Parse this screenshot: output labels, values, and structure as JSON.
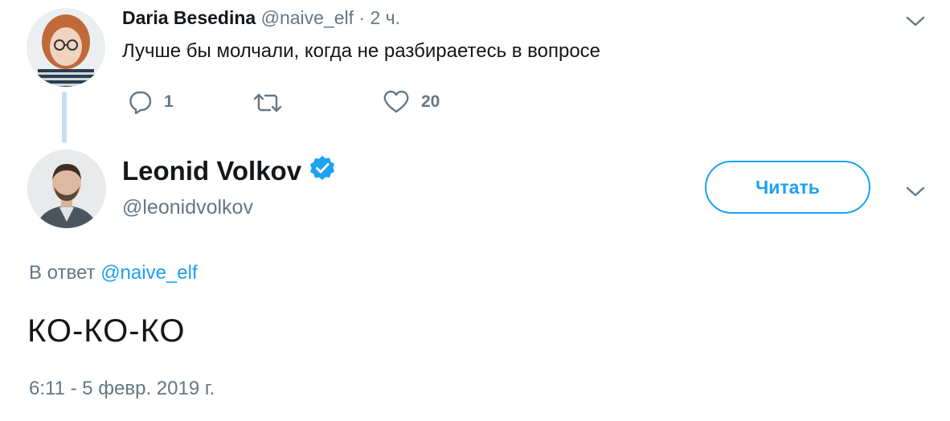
{
  "parent_tweet": {
    "author_name": "Daria Besedina",
    "author_handle": "@naive_elf",
    "separator": "·",
    "time_ago": "2 ч.",
    "text": "Лучше бы молчали, когда не разбираетесь в вопросе",
    "reply_count": "1",
    "retweet_count": "",
    "like_count": "20"
  },
  "main_tweet": {
    "author_name": "Leonid Volkov",
    "verified": true,
    "author_handle": "@leonidvolkov",
    "follow_label": "Читать",
    "reply_prefix": "В ответ",
    "reply_mention": "@naive_elf",
    "text": "КО-КО-КО",
    "timestamp": "6:11 - 5 февр. 2019 г."
  },
  "colors": {
    "accent": "#1da1f2",
    "muted": "#657786",
    "thread_line": "#c4dff5",
    "text": "#14171a"
  },
  "icons": {
    "reply": "reply-icon",
    "retweet": "retweet-icon",
    "like": "heart-icon",
    "more": "chevron-down-icon",
    "verified": "verified-badge-icon"
  }
}
